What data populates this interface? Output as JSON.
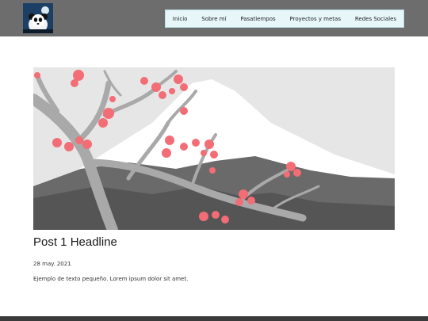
{
  "header": {
    "logo_icon": "panda-avatar-icon",
    "nav": [
      {
        "label": "Inicio"
      },
      {
        "label": "Sobre mí"
      },
      {
        "label": "Pasatiempos"
      },
      {
        "label": "Proyectos y metas"
      },
      {
        "label": "Redes Sociales"
      }
    ]
  },
  "post": {
    "image_icon": "mountain-cherry-blossom-illustration",
    "headline": "Post 1 Headline",
    "date": "28 may. 2021",
    "excerpt": "Ejemplo de texto pequeño. Lorem ipsum dolor sit amet."
  },
  "colors": {
    "header_bg": "#6d6d6d",
    "nav_bg": "#e6f6f9",
    "blossom": "#f26d75",
    "footer_bar": "#3a3a3a"
  }
}
